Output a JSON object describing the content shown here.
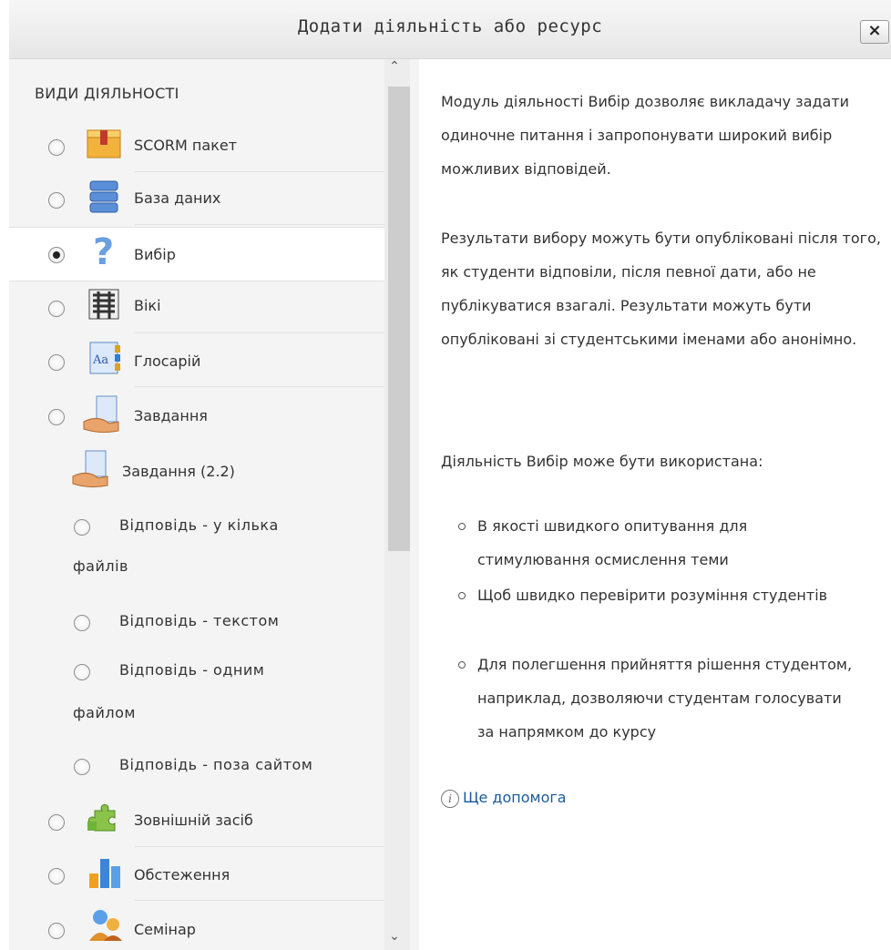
{
  "dialog": {
    "title": "Додати діяльність або ресурс",
    "close_label": "×"
  },
  "options_panel": {
    "heading": "ВИДИ ДІЯЛЬНОСТІ",
    "items": [
      {
        "label": "SCORM пакет",
        "icon": "scorm-package-icon",
        "selected": false
      },
      {
        "label": "База даних",
        "icon": "database-icon",
        "selected": false
      },
      {
        "label": "Вибір",
        "icon": "question-mark-icon",
        "selected": true
      },
      {
        "label": "Вікі",
        "icon": "wiki-icon",
        "selected": false
      },
      {
        "label": "Глосарій",
        "icon": "glossary-icon",
        "selected": false
      },
      {
        "label": "Завдання",
        "icon": "assignment-icon",
        "selected": false
      }
    ],
    "assignment_group": {
      "label": "Завдання (2.2)",
      "icon": "assignment-icon",
      "subitems": [
        {
          "label_line1": "Відповідь - у кілька",
          "label_line2": "файлів",
          "selected": false
        },
        {
          "label_line1": "Відповідь - текстом",
          "label_line2": "",
          "selected": false
        },
        {
          "label_line1": "Відповідь - одним",
          "label_line2": "файлом",
          "selected": false
        },
        {
          "label_line1": "Відповідь - поза сайтом",
          "label_line2": "",
          "selected": false
        }
      ]
    },
    "more_items": [
      {
        "label": "Зовнішній засіб",
        "icon": "puzzle-icon",
        "selected": false
      },
      {
        "label": "Обстеження",
        "icon": "bar-chart-icon",
        "selected": false
      },
      {
        "label": "Семінар",
        "icon": "people-icon",
        "selected": false
      }
    ]
  },
  "help_panel": {
    "para1": "Модуль діяльності Вибір дозволяє викладачу задати одиночне питання і запропонувати широкий вибір можливих відповідей.",
    "para2": "Результати вибору можуть бути опубліковані після того, як студенти відповіли, після певної дати, або не публікуватися взагалі. Результати можуть бути опубліковані зі студентськими іменами або анонімно.",
    "para3": "Діяльність Вибір може бути використана:",
    "bullets": [
      "В якості швидкого опитування для стимулювання осмислення теми",
      "Щоб швидко перевірити розуміння студентів",
      "Для полегшення прийняття рішення студентом, наприклад, дозволяючи студентам голосувати за напрямком до курсу"
    ],
    "more_help": "Ще допомога"
  },
  "colors": {
    "panel_bg": "#f4f4f4",
    "link": "#1a5a9a",
    "selected_bg": "#ffffff"
  }
}
